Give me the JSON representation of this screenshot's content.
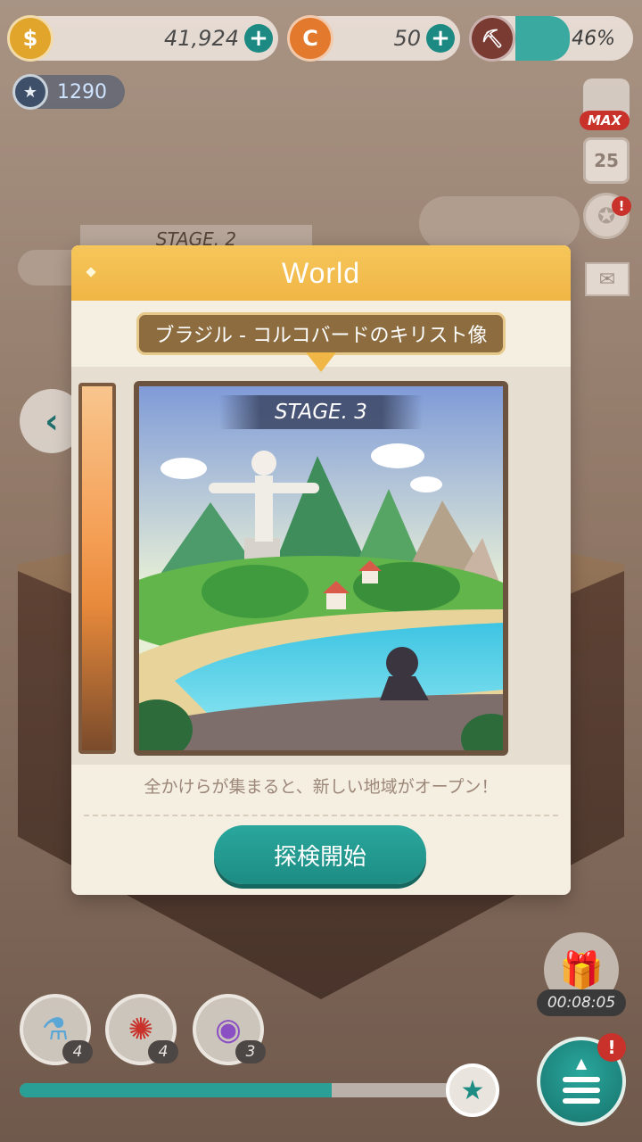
{
  "topbar": {
    "gold": {
      "icon": "gold-coin-icon",
      "value": "41,924",
      "add": "+"
    },
    "gem": {
      "icon": "c-coin-icon",
      "value": "50",
      "add": "+"
    },
    "mine": {
      "icon": "mine-cart-icon",
      "percent_text": "46%",
      "fill": 0.46
    }
  },
  "medal": {
    "icon": "medal-icon",
    "value": "1290"
  },
  "side": {
    "max_badge": "MAX",
    "calendar_day": "25",
    "alert": "!"
  },
  "background": {
    "stage_label": "STAGE. 2"
  },
  "modal": {
    "title": "World",
    "location": "ブラジル - コルコバードのキリスト像",
    "stage_label": "STAGE. 3",
    "hint": "全かけらが集まると、新しい地域がオープン！",
    "start_button": "探検開始"
  },
  "items": [
    {
      "icon": "potion-icon",
      "count": "4"
    },
    {
      "icon": "dynamite-icon",
      "count": "4"
    },
    {
      "icon": "candy-ball-icon",
      "count": "3"
    }
  ],
  "progress": {
    "fill": 0.7
  },
  "gift": {
    "timer": "00:08:05"
  },
  "menu": {
    "alert": "!"
  },
  "colors": {
    "accent": "#1d8c83",
    "header": "#f0b646",
    "alert": "#c8322a"
  }
}
